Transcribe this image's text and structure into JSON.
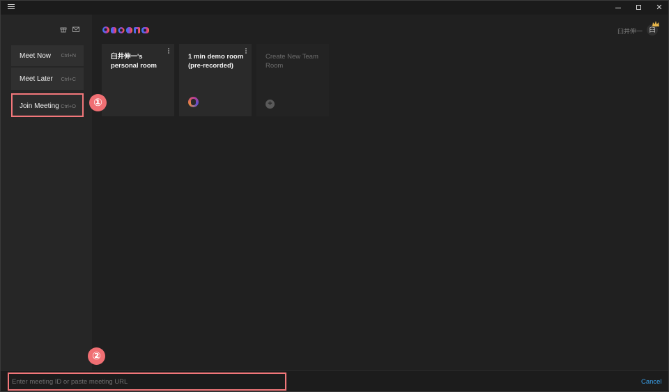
{
  "titlebar": {
    "minimize_glyph": "",
    "maximize_glyph": "",
    "close_glyph": "✕"
  },
  "sidebar": {
    "meet_now": {
      "label": "Meet Now",
      "shortcut": "Ctrl+N"
    },
    "meet_later": {
      "label": "Meet Later",
      "shortcut": "Ctrl+C"
    },
    "join_meeting": {
      "label": "Join Meeting",
      "shortcut": "Ctrl+O"
    }
  },
  "annotations": {
    "marker_1": "①",
    "marker_2": "②"
  },
  "header": {
    "user_name": "臼井伸一",
    "avatar_initial": "臼"
  },
  "rooms": [
    {
      "title": "臼井伸一's personal room"
    },
    {
      "title": "1 min demo room (pre-recorded)"
    },
    {
      "title": "Create New Team Room",
      "plus": "+"
    }
  ],
  "join_bar": {
    "placeholder": "Enter meeting ID or paste meeting URL",
    "cancel_label": "Cancel"
  },
  "colors": {
    "highlight": "#f2777a",
    "accent_link": "#3a9ee6"
  }
}
